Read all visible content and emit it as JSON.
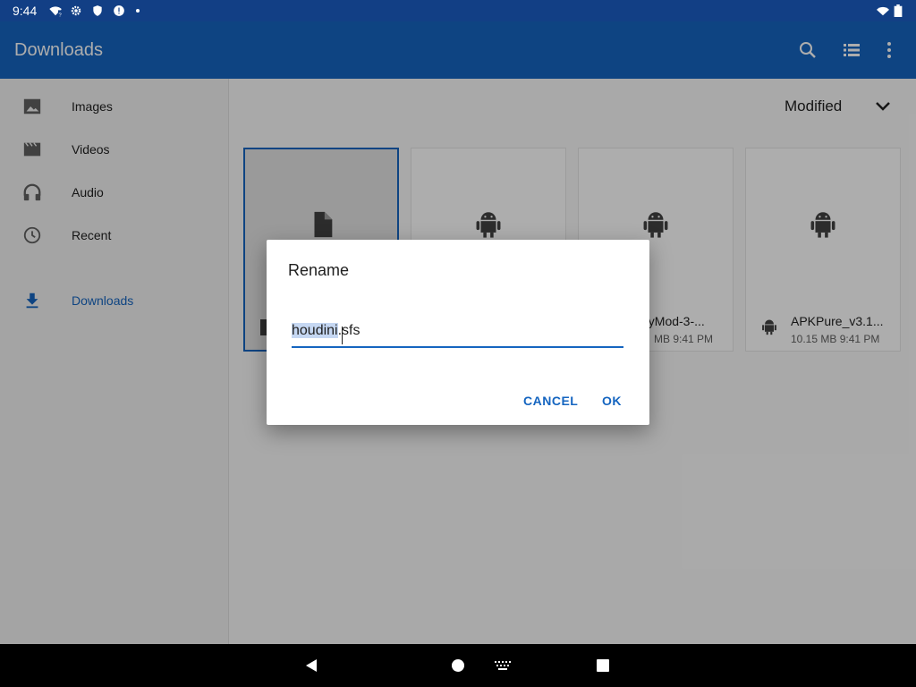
{
  "status_bar": {
    "time": "9:44",
    "icons": [
      "wifi-question-icon",
      "settings-icon",
      "shield-icon",
      "alert-icon",
      "dot-icon",
      "wifi-icon",
      "battery-icon"
    ]
  },
  "app_bar": {
    "title": "Downloads",
    "actions": [
      "search-icon",
      "list-view-icon",
      "more-vert-icon"
    ]
  },
  "sidebar": {
    "items": [
      {
        "label": "Images",
        "icon": "image-icon"
      },
      {
        "label": "Videos",
        "icon": "movie-icon"
      },
      {
        "label": "Audio",
        "icon": "headphones-icon"
      },
      {
        "label": "Recent",
        "icon": "clock-icon"
      },
      {
        "label": "Downloads",
        "icon": "download-icon",
        "active": true
      }
    ]
  },
  "content": {
    "sort": {
      "label": "Modified",
      "icon": "chevron-down-icon"
    },
    "files": [
      {
        "name": "",
        "info": "",
        "icon": "file-icon",
        "selected": true
      },
      {
        "name": "",
        "info": "",
        "icon": "android-icon"
      },
      {
        "name": "pyMod-3-...",
        "info": "MB 9:41 PM",
        "icon": "android-icon"
      },
      {
        "name": "APKPure_v3.1...",
        "info": "10.15 MB 9:41 PM",
        "icon": "android-icon"
      }
    ]
  },
  "dialog": {
    "title": "Rename",
    "field_selected": "houdini",
    "field_rest": ".sfs",
    "cancel_label": "CANCEL",
    "ok_label": "OK"
  },
  "nav_bar": {
    "buttons": [
      "back-icon",
      "home-icon",
      "keyboard-icon",
      "recents-icon"
    ]
  },
  "colors": {
    "status_bar": "#123f85",
    "app_bar": "#1565c0",
    "accent": "#1565c0"
  }
}
